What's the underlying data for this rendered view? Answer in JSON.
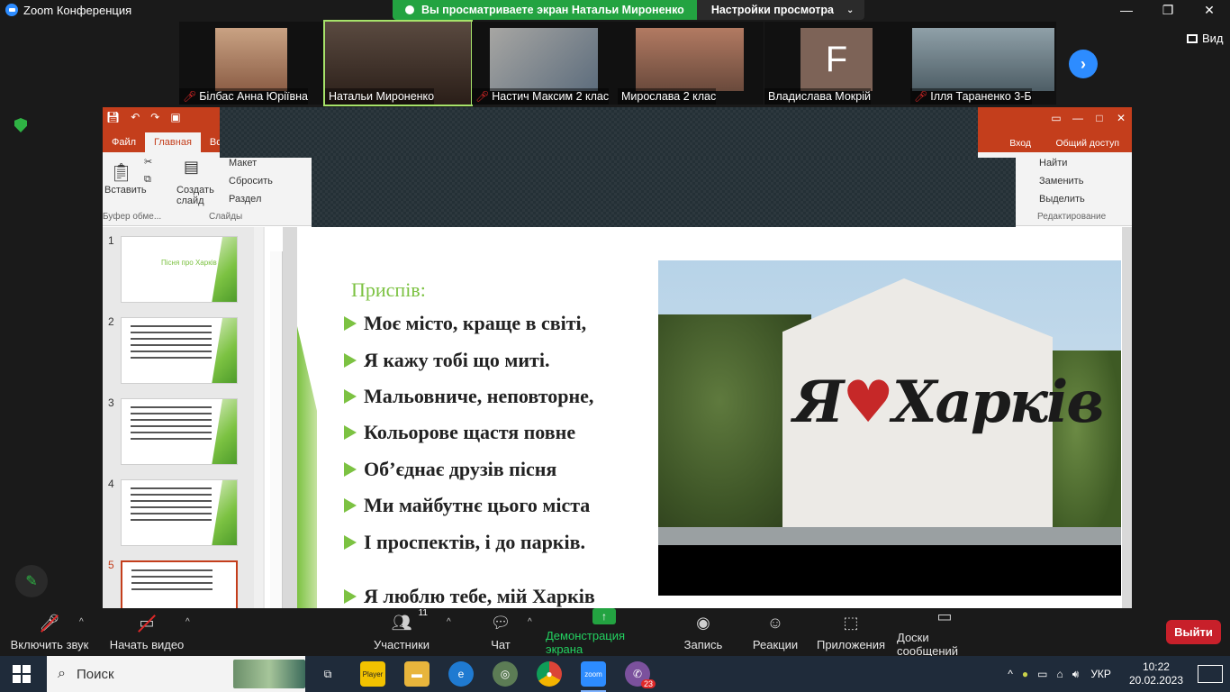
{
  "window": {
    "title": "Zoom Конференция",
    "controls": [
      "—",
      "❐",
      "✕"
    ]
  },
  "share_banner": {
    "status": "Вы просматриваете экран Натальи Мироненко",
    "settings": "Настройки просмотра"
  },
  "view_button": "Вид",
  "participants_strip": [
    {
      "name": "Білбас Анна Юріївна",
      "muted": true,
      "color": "#b9876a"
    },
    {
      "name": "Натальи Мироненко",
      "muted": false,
      "active": true,
      "color": "#3a2a22"
    },
    {
      "name": "Настич Максим 2 клас",
      "muted": true,
      "color": "#8c8a88"
    },
    {
      "name": "Мирослава 2 клас",
      "muted": false,
      "color": "#c48a6e"
    },
    {
      "name": "Владислава Мокрій",
      "muted": false,
      "avatar_letter": "F"
    },
    {
      "name": "Ілля Тараненко 3-Б",
      "muted": true,
      "color": "#6f7f88"
    }
  ],
  "powerpoint": {
    "tabs": [
      "Файл",
      "Главная",
      "Вс"
    ],
    "right_links": {
      "login": "Вход",
      "share": "Общий доступ"
    },
    "ribbon": {
      "paste": "Вставить",
      "clipboard_group": "Буфер обме...",
      "new_slide": "Создать слайд",
      "slides_group": "Слайды",
      "layout": "Макет",
      "reset": "Сбросить",
      "section": "Раздел",
      "find": "Найти",
      "replace": "Заменить",
      "select": "Выделить",
      "editing_group": "Редактирование"
    },
    "thumbnails": [
      {
        "num": "1",
        "title": "Пісня про Харків"
      },
      {
        "num": "2"
      },
      {
        "num": "3"
      },
      {
        "num": "4"
      },
      {
        "num": "5",
        "selected": true
      }
    ],
    "slide": {
      "heading": "Приспів:",
      "lines": [
        "Моє місто, краще в світі,",
        "Я кажу тобі що миті.",
        "Мальовниче, неповторне,",
        "Кольорове щастя повне",
        "Об’єднає друзів пісня",
        "Ми майбутнє цього міста",
        "І проспектів, і до парків."
      ],
      "last_line": "Я люблю тебе, мій Харків",
      "graffiti_text_left": "Я",
      "graffiti_heart": "♥",
      "graffiti_text_right": "Харків"
    }
  },
  "toolbar": {
    "unmute": "Включить звук",
    "start_video": "Начать видео",
    "participants": "Участники",
    "participants_count": "11",
    "chat": "Чат",
    "share_screen": "Демонстрация экрана",
    "record": "Запись",
    "reactions": "Реакции",
    "apps": "Приложения",
    "whiteboards": "Доски сообщений",
    "leave": "Выйти"
  },
  "taskbar": {
    "search_placeholder": "Поиск",
    "language": "УКР",
    "time": "10:22",
    "date": "20.02.2023",
    "viber_badge": "23",
    "player_label": "Player"
  }
}
